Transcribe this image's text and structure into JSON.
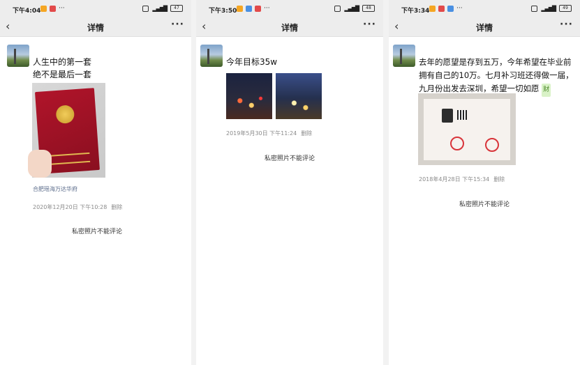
{
  "panels": [
    {
      "status": {
        "time": "下午4:04",
        "more": "···",
        "battery": "47"
      },
      "nav": {
        "back": "‹",
        "title": "详情",
        "more": "···"
      },
      "post": {
        "text_lines": [
          "人生中的第一套",
          "绝不是最后一套"
        ],
        "location": "合肥瑶海万达华府",
        "time": "2020年12月20日 下午10:28",
        "delete": "删除",
        "no_comment": "私密照片不能评论"
      }
    },
    {
      "status": {
        "time": "下午3:50",
        "more": "···",
        "battery": "48"
      },
      "nav": {
        "back": "‹",
        "title": "详情",
        "more": "···"
      },
      "post": {
        "text_lines": [
          "今年目标35w"
        ],
        "time": "2019年5月30日 下午11:24",
        "delete": "删除",
        "no_comment": "私密照片不能评论"
      }
    },
    {
      "status": {
        "time": "下午3:34",
        "more": "···",
        "battery": "49"
      },
      "nav": {
        "back": "‹",
        "title": "详情",
        "more": "···"
      },
      "post": {
        "text_lines": [
          "去年的愿望是存到五万，今年希望在毕业前",
          "拥有自己的10万。七月补习班还得做一届，",
          "九月份出发去深圳，希望一切如愿"
        ],
        "emoji": "财",
        "time": "2018年4月28日 下午15:34",
        "delete": "删除",
        "no_comment": "私密照片不能评论"
      }
    }
  ],
  "colors": {
    "bar_bg": "#ededed",
    "meta_gray": "#8a8a8a",
    "location_blue": "#5a6b8a"
  }
}
